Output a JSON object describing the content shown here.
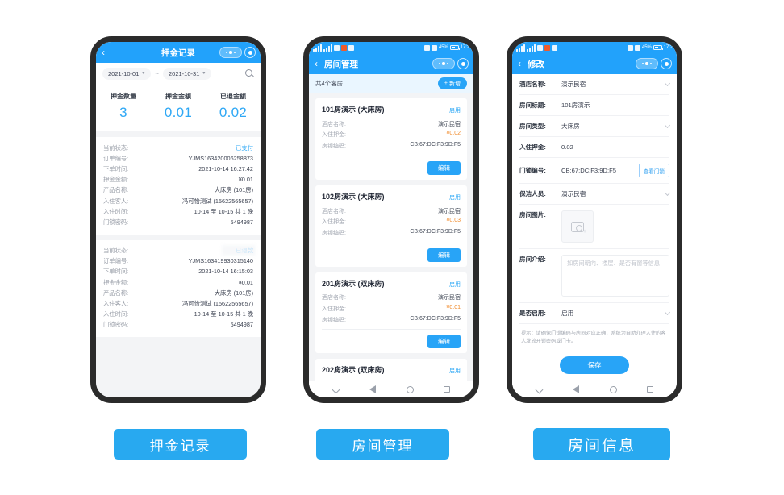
{
  "statusbar": {
    "battery": "45%",
    "time": "17:2"
  },
  "phone1": {
    "nav": {
      "title": "押金记录",
      "back_icon": "chevron-left-icon"
    },
    "filter": {
      "date_from": "2021-10-01",
      "date_to": "2021-10-31",
      "separator": "~",
      "search_icon": "search-icon"
    },
    "stats": [
      {
        "label": "押金数量",
        "value": "3"
      },
      {
        "label": "押金金额",
        "value": "0.01"
      },
      {
        "label": "已退金额",
        "value": "0.02"
      }
    ],
    "records": [
      {
        "rows": [
          {
            "k": "当前状态:",
            "v": "已支付",
            "style": "blue"
          },
          {
            "k": "订单编号:",
            "v": "YJMS163420006258873",
            "style": ""
          },
          {
            "k": "下单时间:",
            "v": "2021-10-14 16:27:42",
            "style": ""
          },
          {
            "k": "押金金额:",
            "v": "¥0.01",
            "style": ""
          },
          {
            "k": "产品名称:",
            "v": "大床房 (101房)",
            "style": ""
          },
          {
            "k": "入住客人:",
            "v": "冯可怡测试 (15622565657)",
            "style": ""
          },
          {
            "k": "入住时间:",
            "v": "10-14 至 10-15 共 1 晚",
            "style": ""
          },
          {
            "k": "门锁密码:",
            "v": "5494987",
            "style": ""
          }
        ]
      },
      {
        "rows": [
          {
            "k": "当前状态:",
            "v": "已退款",
            "style": "blue"
          },
          {
            "k": "订单编号:",
            "v": "YJMS163419930315140",
            "style": ""
          },
          {
            "k": "下单时间:",
            "v": "2021-10-14 16:15:03",
            "style": ""
          },
          {
            "k": "押金金额:",
            "v": "¥0.01",
            "style": ""
          },
          {
            "k": "产品名称:",
            "v": "大床房 (101房)",
            "style": ""
          },
          {
            "k": "入住客人:",
            "v": "冯可怡测试 (15622565657)",
            "style": ""
          },
          {
            "k": "入住时间:",
            "v": "10-14 至 10-15 共 1 晚",
            "style": ""
          },
          {
            "k": "门锁密码:",
            "v": "5494987",
            "style": ""
          }
        ]
      }
    ]
  },
  "phone2": {
    "nav": {
      "title": "房间管理",
      "back_icon": "chevron-left-icon"
    },
    "subbar": {
      "count_text": "共4个客房",
      "add_label": "新增",
      "add_icon": "plus-icon"
    },
    "labels": {
      "hotel": "酒店名称:",
      "deposit": "入住押金:",
      "lock": "房锁编码:",
      "edit": "编辑"
    },
    "rooms": [
      {
        "title": "101房演示 (大床房)",
        "state": "启用",
        "hotel": "演示民宿",
        "deposit": "¥0.02",
        "lock": "CB:67:DC:F3:9D:F5"
      },
      {
        "title": "102房演示 (大床房)",
        "state": "启用",
        "hotel": "演示民宿",
        "deposit": "¥0.03",
        "lock": "CB:67:DC:F3:9D:F5"
      },
      {
        "title": "201房演示 (双床房)",
        "state": "启用",
        "hotel": "演示民宿",
        "deposit": "¥0.01",
        "lock": "CB:67:DC:F3:9D:F5"
      },
      {
        "title": "202房演示 (双床房)",
        "state": "启用",
        "hotel": "",
        "deposit": "",
        "lock": ""
      }
    ]
  },
  "phone3": {
    "nav": {
      "title": "修改",
      "back_icon": "chevron-left-icon"
    },
    "fields": [
      {
        "label": "酒店名称:",
        "value": "演示民宿",
        "type": "select"
      },
      {
        "label": "房间标题:",
        "value": "101房演示",
        "type": "text"
      },
      {
        "label": "房间类型:",
        "value": "大床房",
        "type": "select"
      },
      {
        "label": "入住押金:",
        "value": "0.02",
        "type": "text"
      },
      {
        "label": "门锁编号:",
        "value": "CB:67:DC:F3:9D:F5",
        "type": "lock"
      },
      {
        "label": "保洁人员:",
        "value": "演示民宿",
        "type": "select"
      },
      {
        "label": "房间图片:",
        "value": "",
        "type": "photo"
      },
      {
        "label": "房间介绍:",
        "value": "",
        "type": "textarea"
      },
      {
        "label": "是否启用:",
        "value": "启用",
        "type": "select"
      }
    ],
    "view_lock_label": "查看门锁",
    "photo_icon": "camera-add-icon",
    "intro_placeholder": "如房间朝向、楼层、是否有窗等信息",
    "tip": "提示：请确保门锁编码与房间对应正确，系统为自助办理入住的客人发放开锁密码或门卡。",
    "save_label": "保存"
  },
  "androidnav": {
    "icons": [
      "chevron-down-icon",
      "back-triangle-icon",
      "home-circle-icon",
      "recents-square-icon"
    ]
  },
  "captions": {
    "one": "押金记录",
    "two": "房间管理",
    "three": "房间信息"
  },
  "colors": {
    "accent": "#28a4f7",
    "header": "#22a2fb",
    "value_blue": "#2fa8f5",
    "money_orange": "#f08a2a"
  }
}
